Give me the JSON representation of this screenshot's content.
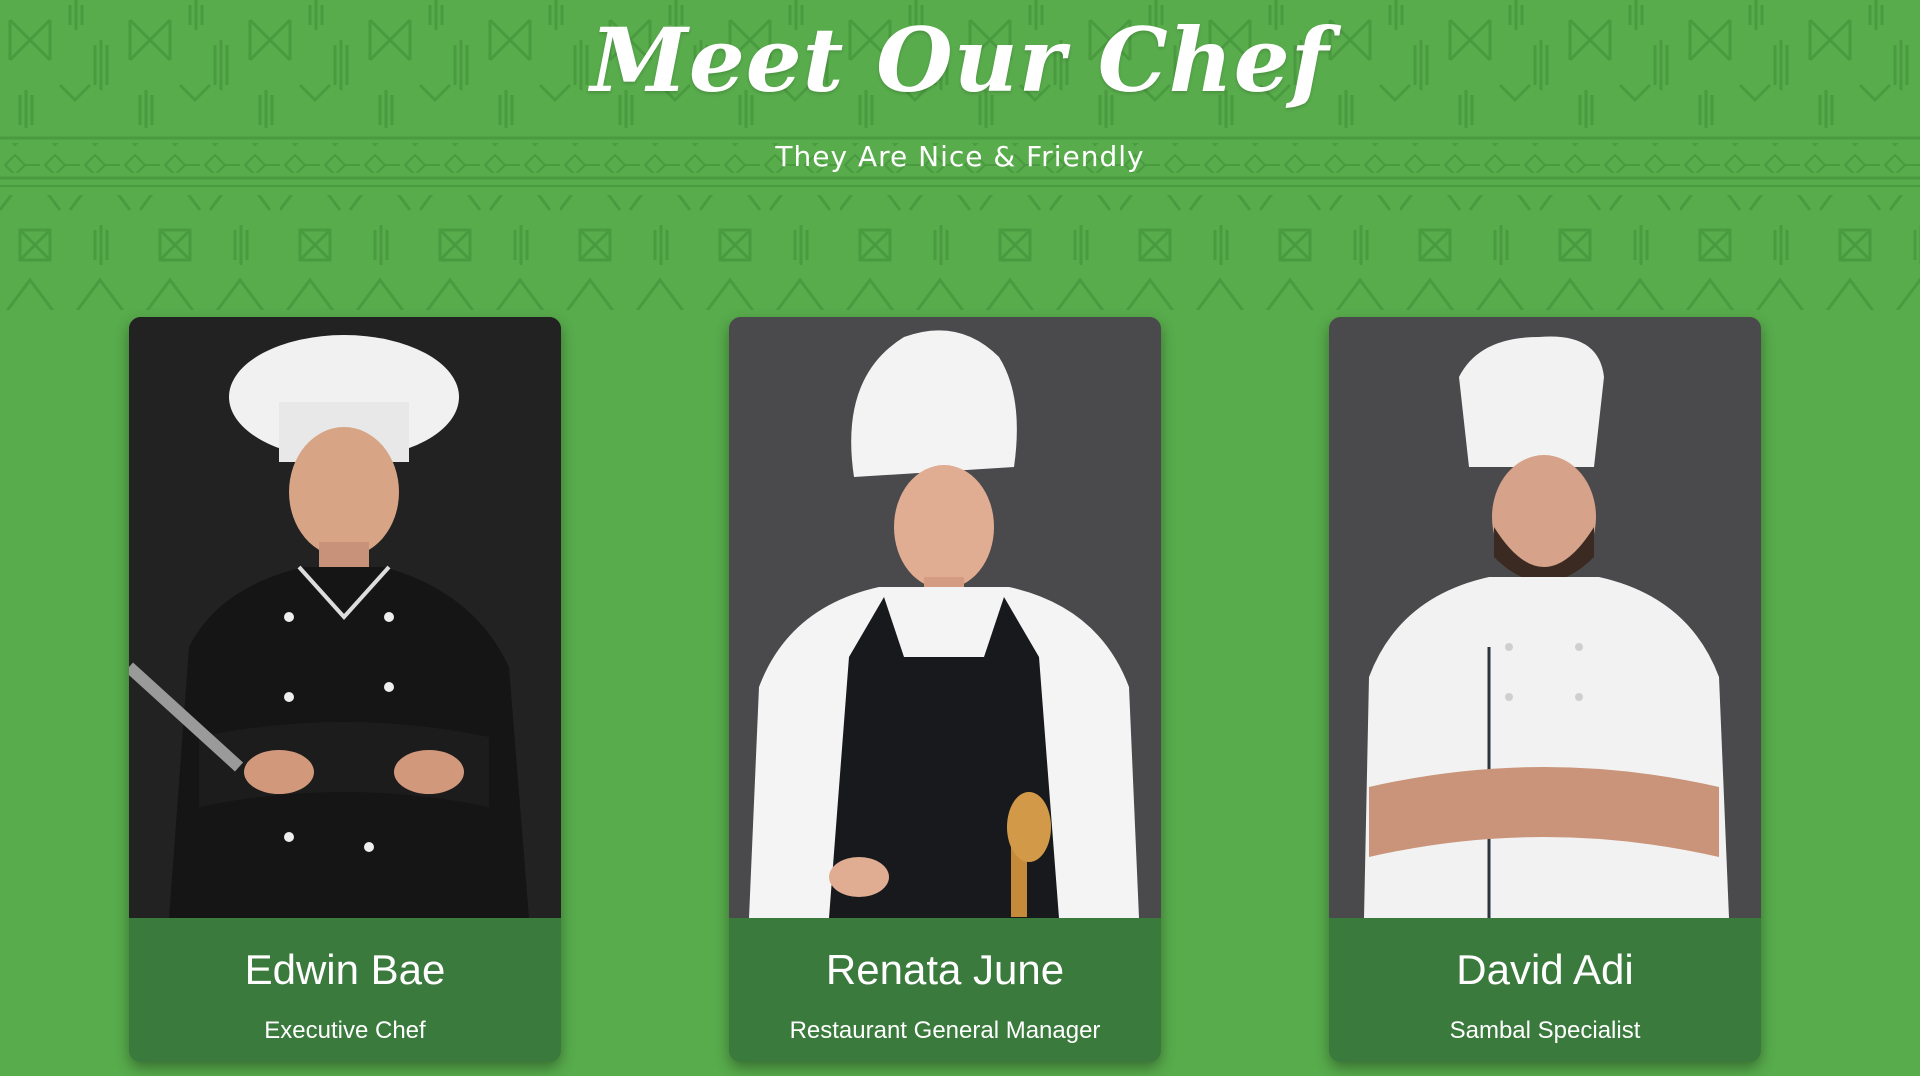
{
  "section": {
    "title": "Meet Our Chef",
    "subtitle": "They Are Nice & Friendly"
  },
  "chefs": [
    {
      "name": "Edwin Bae",
      "role": "Executive Chef",
      "photo": "chef-black-jacket-photo"
    },
    {
      "name": "Renata June",
      "role": "Restaurant General Manager",
      "photo": "chef-apron-photo"
    },
    {
      "name": "David Adi",
      "role": "Sambal Specialist",
      "photo": "chef-white-jacket-photo"
    }
  ],
  "colors": {
    "background": "#58ac4c",
    "pattern": "#4a9a40",
    "card_footer": "#3b7a3d",
    "text": "#ffffff"
  }
}
